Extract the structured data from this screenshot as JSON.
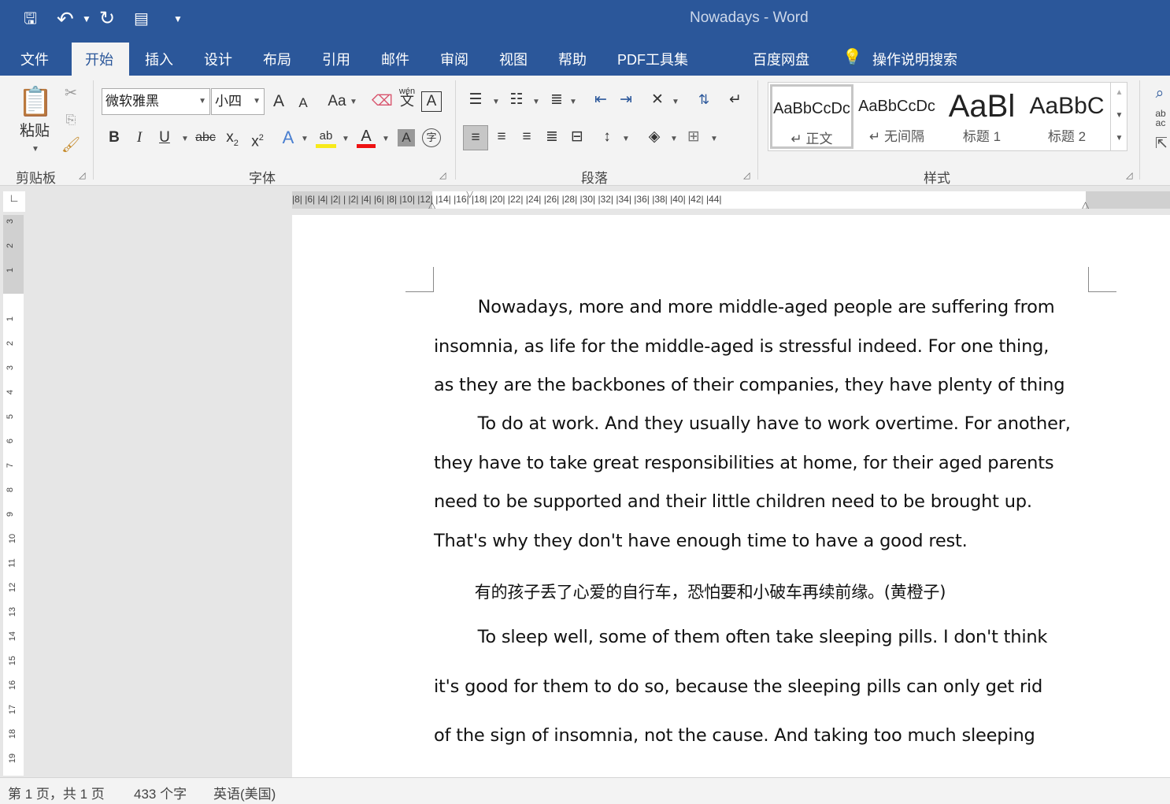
{
  "titlebar": {
    "title": "Nowadays  -  Word",
    "accent": "#2b579a"
  },
  "qat": [
    {
      "icon": "save-icon",
      "glyph": "💾"
    },
    {
      "icon": "undo-icon",
      "glyph": "↶"
    },
    {
      "icon": "undo-dropdown-icon",
      "glyph": "▾"
    },
    {
      "icon": "redo-icon",
      "glyph": "↻"
    },
    {
      "icon": "touch-mode-icon",
      "glyph": "▤"
    },
    {
      "icon": "customize-qat-icon",
      "glyph": "▾"
    }
  ],
  "tabs": [
    "文件",
    "开始",
    "插入",
    "设计",
    "布局",
    "引用",
    "邮件",
    "审阅",
    "视图",
    "帮助",
    "PDF工具集",
    "百度网盘"
  ],
  "tell_me": "操作说明搜索",
  "ribbon": {
    "clipboard": {
      "paste": "粘贴",
      "label": "剪贴板"
    },
    "font": {
      "name": "微软雅黑",
      "size": "小四",
      "label": "字体",
      "grow": "A",
      "shrink": "A",
      "case": "Aa",
      "phonetic": "wén",
      "phonetic_char": "文",
      "bold": "B",
      "italic": "I",
      "underline": "U",
      "strike": "abc",
      "sub": "x",
      "sub2": "2",
      "sup": "x",
      "sup2": "2",
      "effects": "A",
      "highlight": "ab",
      "color": "A",
      "shade": "A",
      "encircle": "字"
    },
    "paragraph": {
      "label": "段落"
    },
    "styles": {
      "label": "样式",
      "items": [
        {
          "preview": "AaBbCcDc",
          "name": "↵ 正文"
        },
        {
          "preview": "AaBbCcDc",
          "name": "↵ 无间隔"
        },
        {
          "preview": "AaBl",
          "name": "标题 1"
        },
        {
          "preview": "AaBbC",
          "name": "标题 2"
        }
      ]
    }
  },
  "ruler": {
    "marks": "|8|  |6|  |4|  |2|  |  |2|  |4|  |6|  |8|  |10|  |12|  |14|  |16|  |18|  |20|  |22|  |24|  |26|  |28|  |30|  |32|  |34|  |36|  |38|  |40|  |42|  |44|"
  },
  "vruler": [
    "3",
    "2",
    "1",
    "1",
    "1",
    "2",
    "3",
    "4",
    "5",
    "6",
    "7",
    "8",
    "9",
    "10",
    "11",
    "12",
    "13",
    "14",
    "15",
    "16",
    "17",
    "18",
    "19"
  ],
  "document": {
    "paragraphs": [
      "        Nowadays, more and more middle-aged people are suffering from",
      "insomnia, as life for the middle-aged is stressful indeed. For one thing,",
      "as they are the backbones of their companies, they have plenty of thing",
      "        To do at work. And they usually have to work overtime. For another,",
      "they have to take great responsibilities at home, for their aged parents",
      "need to be supported and their little children need to be brought up.",
      "That's why they don't have enough time to have a good rest.",
      "        有的孩子丢了心爱的自行车，恐怕要和小破车再续前缘。(黄橙子)",
      "        To sleep well, some of them often take sleeping pills. I don't think",
      "it's good for them to do so, because the sleeping pills can only get rid",
      "of the sign of insomnia, not the cause. And taking too much sleeping"
    ]
  },
  "status": {
    "page": "第 1 页，共 1 页",
    "words": "433 个字",
    "language": "英语(美国)"
  }
}
